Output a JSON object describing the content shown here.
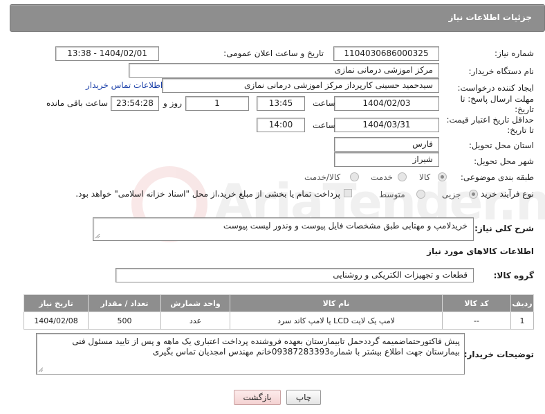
{
  "header": {
    "title": "جزئیات اطلاعات نیاز"
  },
  "fields": {
    "need_number_label": "شماره نیاز:",
    "need_number": "1104030686000325",
    "announce_label": "تاریخ و ساعت اعلان عمومی:",
    "announce_value": "1404/02/01 - 13:38",
    "buyer_org_label": "نام دستگاه خریدار:",
    "buyer_org": "مرکز اموزشی درمانی نمازی",
    "creator_label": "ایجاد کننده درخواست:",
    "creator": "سیدحمید حسینی کارپرداز مرکز اموزشی درمانی نمازی",
    "contact_link": "اطلاعات تماس خریدار",
    "deadline_label_1": "مهلت ارسال پاسخ: تا",
    "deadline_label_2": "تاریخ:",
    "deadline_date": "1404/02/03",
    "time_label": "ساعت",
    "deadline_time": "13:45",
    "day_count": "1",
    "days_label": "روز و",
    "remaining_time": "23:54:28",
    "remaining_label": "ساعت باقی مانده",
    "validity_label_1": "حداقل تاریخ اعتبار قیمت:",
    "validity_label_2": "تا تاریخ:",
    "validity_date": "1404/03/31",
    "validity_time": "14:00",
    "province_label": "استان محل تحویل:",
    "province": "فارس",
    "city_label": "شهر محل تحویل:",
    "city": "شیراز",
    "category_label": "طبقه بندی موضوعی:",
    "category_options": [
      "کالا",
      "خدمت",
      "کالا/خدمت"
    ],
    "category_selected": "کالا",
    "process_label": "نوع فرآیند خرید :",
    "process_options": [
      "جزیی",
      "متوسط"
    ],
    "process_selected": "جزیی",
    "payment_note": "پرداخت تمام یا بخشی از مبلغ خرید،از محل \"اسناد خزانه اسلامی\" خواهد بود."
  },
  "description": {
    "label": "شرح کلی نیاز:",
    "text": "خریدلامپ و مهتابی طبق مشخصات فایل پیوست و وندور لیست پیوست"
  },
  "goods": {
    "section_title": "اطلاعات کالاهای مورد نیاز",
    "group_label": "گروه کالا:",
    "group_value": "قطعات و تجهیزات الکتریکی و روشنایی",
    "columns": [
      "ردیف",
      "کد کالا",
      "نام کالا",
      "واحد شمارش",
      "تعداد / مقدار",
      "تاریخ نیاز"
    ],
    "rows": [
      {
        "row": "1",
        "code": "--",
        "name": "لامپ یک لایت LCD یا لامپ کاتد سرد",
        "unit": "عدد",
        "qty": "500",
        "date": "1404/02/08"
      }
    ]
  },
  "notes": {
    "label": "توضیحات خریدار:",
    "text": "پیش فاکتورحتماضمیمه گرددحمل تابیمارستان بعهده فروشنده  پرداخت اعتباری یک ماهه  و پس از تایید مسئول فنی بیمارستان جهت اطلاع بیشتر با شماره09387283393خانم مهندس امجدیان تماس بگیری"
  },
  "buttons": {
    "print": "چاپ",
    "back": "بازگشت"
  },
  "watermark": {
    "text": "AriaTender.net"
  },
  "colors": {
    "header_bg": "#8e8e8e",
    "link": "#1a3fa8",
    "back_button_bg": "#f8dada"
  }
}
